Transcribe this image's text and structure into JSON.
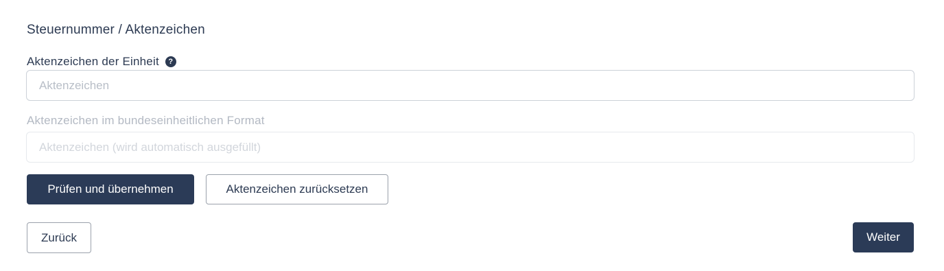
{
  "section": {
    "title": "Steuernummer / Aktenzeichen"
  },
  "fields": {
    "einheit": {
      "label": "Aktenzeichen der Einheit",
      "help_icon": "question-circle-icon",
      "help_glyph": "?",
      "placeholder": "Aktenzeichen",
      "value": ""
    },
    "bundesformat": {
      "label": "Aktenzeichen im bundeseinheitlichen Format",
      "placeholder": "Aktenzeichen (wird automatisch ausgefüllt)",
      "value": "",
      "disabled": true
    }
  },
  "actions": {
    "check_label": "Prüfen und übernehmen",
    "reset_label": "Aktenzeichen zurücksetzen"
  },
  "navigation": {
    "back_label": "Zurück",
    "next_label": "Weiter"
  },
  "colors": {
    "primary": "#2b3b57",
    "text": "#2c3a52",
    "muted": "#b3b9c3",
    "border": "#ccd1d8"
  }
}
